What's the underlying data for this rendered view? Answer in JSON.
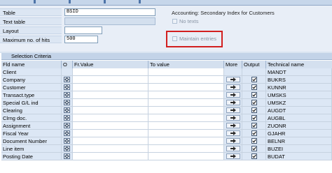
{
  "form": {
    "table_label": "Table",
    "table_value": "BSID",
    "text_table_label": "Text table",
    "text_table_value": "",
    "layout_label": "Layout",
    "layout_value": "",
    "max_hits_label": "Maximum no. of hits",
    "max_hits_value": "500",
    "table_description": "Accounting: Secondary Index for Customers",
    "no_texts_label": "No texts",
    "maintain_entries_label": "Maintain entries"
  },
  "grid": {
    "title": "Selection Criteria",
    "columns": {
      "fld_name": "Fld name",
      "o": "O",
      "fr_value": "Fr.Value",
      "to_value": "To value",
      "more": "More",
      "output": "Output",
      "technical_name": "Technical name"
    },
    "rows": [
      {
        "name": "Client",
        "tech": "MANDT",
        "selectable": false
      },
      {
        "name": "Company",
        "tech": "BUKRS",
        "selectable": true
      },
      {
        "name": "Customer",
        "tech": "KUNNR",
        "selectable": true
      },
      {
        "name": "Transact.type",
        "tech": "UMSKS",
        "selectable": true
      },
      {
        "name": "Special G/L ind",
        "tech": "UMSKZ",
        "selectable": true
      },
      {
        "name": "Clearing",
        "tech": "AUGDT",
        "selectable": true
      },
      {
        "name": "Clrng doc.",
        "tech": "AUGBL",
        "selectable": true
      },
      {
        "name": "Assignment",
        "tech": "ZUONR",
        "selectable": true
      },
      {
        "name": "Fiscal Year",
        "tech": "GJAHR",
        "selectable": true
      },
      {
        "name": "Document Number",
        "tech": "BELNR",
        "selectable": true
      },
      {
        "name": "Line item",
        "tech": "BUZEI",
        "selectable": true
      },
      {
        "name": "Posting Date",
        "tech": "BUDAT",
        "selectable": true
      }
    ]
  }
}
